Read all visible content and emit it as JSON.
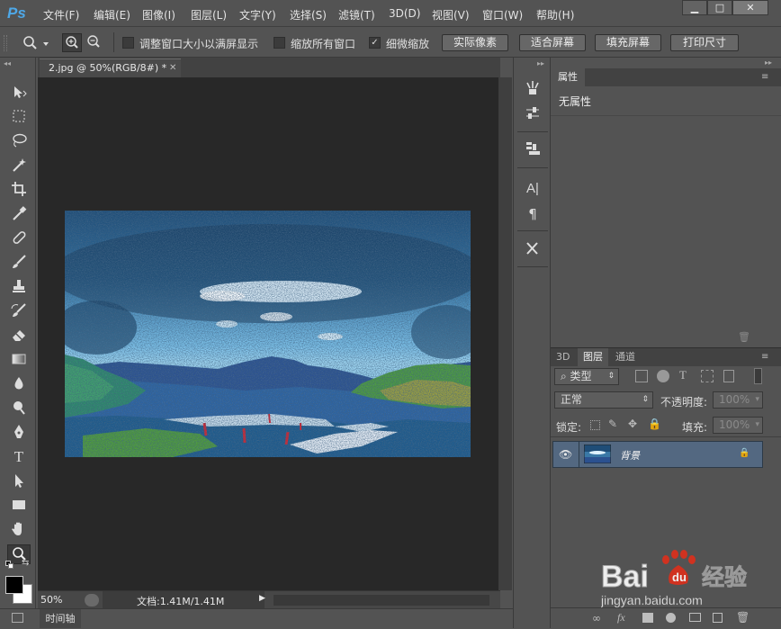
{
  "app": {
    "logo": "Ps"
  },
  "menu": [
    "文件(F)",
    "编辑(E)",
    "图像(I)",
    "图层(L)",
    "文字(Y)",
    "选择(S)",
    "滤镜(T)",
    "3D(D)",
    "视图(V)",
    "窗口(W)",
    "帮助(H)"
  ],
  "window_controls": {
    "minimize": "▁",
    "restore": "□",
    "close": "✕"
  },
  "options": {
    "resize_windows_label": "调整窗口大小以满屏显示",
    "resize_windows_checked": false,
    "zoom_all_label": "缩放所有窗口",
    "zoom_all_checked": false,
    "scrubby_zoom_label": "细微缩放",
    "scrubby_zoom_checked": true,
    "check_mark": "✓",
    "actual_pixels_button": "实际像素",
    "fit_screen_button": "适合屏幕",
    "fill_screen_button": "填充屏幕",
    "print_size_button": "打印尺寸"
  },
  "document": {
    "tab_title": "2.jpg @ 50%(RGB/8#) *",
    "tab_close": "✕",
    "zoom_level": "50%",
    "doc_info": "文档:1.41M/1.41M"
  },
  "timeline": {
    "label": "时间轴"
  },
  "properties_panel": {
    "tab": "属性",
    "content": "无属性"
  },
  "layers_panel": {
    "tabs": [
      "3D",
      "图层",
      "通道"
    ],
    "filter_label": "类型",
    "blend_mode": "正常",
    "opacity_label": "不透明度:",
    "opacity_value": "100%",
    "lock_label": "锁定:",
    "fill_label": "填充:",
    "fill_value": "100%",
    "layers": [
      {
        "name": "背景",
        "visible": true,
        "locked": true
      }
    ]
  },
  "watermark": {
    "brand": "Bai du 经验",
    "url": "jingyan.baidu.com"
  },
  "colors": {
    "ui_gray": "#535353",
    "canvas_bg": "#282828",
    "selected_layer": "#536881",
    "ps_blue": "#4ea8e8",
    "baidu_red": "#de2f1b",
    "baidu_blue": "#2d5bd7"
  }
}
